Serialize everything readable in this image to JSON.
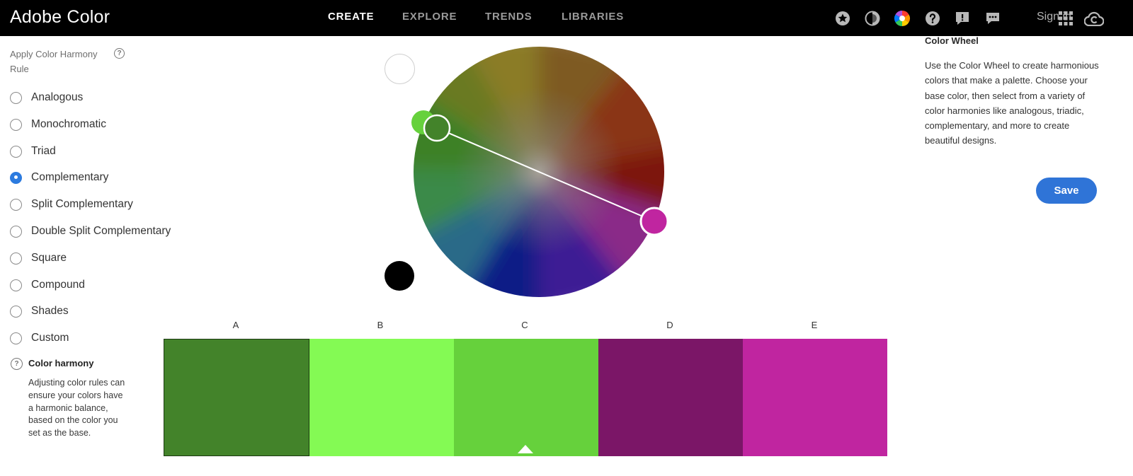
{
  "app": {
    "title": "Adobe Color"
  },
  "nav": {
    "items": [
      {
        "label": "CREATE",
        "active": true
      },
      {
        "label": "EXPLORE",
        "active": false
      },
      {
        "label": "TRENDS",
        "active": false
      },
      {
        "label": "LIBRARIES",
        "active": false
      }
    ]
  },
  "header_icons": [
    "star-icon",
    "contrast-icon",
    "color-wheel-icon",
    "help-icon",
    "feedback-icon",
    "chat-icon",
    "apps-grid-icon",
    "creative-cloud-icon"
  ],
  "header": {
    "sign_in": "Sign in"
  },
  "harmony_panel": {
    "title": "Apply Color Harmony Rule",
    "rules": [
      {
        "label": "Analogous",
        "selected": false
      },
      {
        "label": "Monochromatic",
        "selected": false
      },
      {
        "label": "Triad",
        "selected": false
      },
      {
        "label": "Complementary",
        "selected": true
      },
      {
        "label": "Split Complementary",
        "selected": false
      },
      {
        "label": "Double Split Complementary",
        "selected": false
      },
      {
        "label": "Square",
        "selected": false
      },
      {
        "label": "Compound",
        "selected": false
      },
      {
        "label": "Shades",
        "selected": false
      },
      {
        "label": "Custom",
        "selected": false
      }
    ],
    "note_title": "Color harmony",
    "note_text": "Adjusting color rules can ensure your colors have a harmonic balance, based on the color you set as the base."
  },
  "palette": {
    "columns": [
      {
        "letter": "A",
        "color": "#43832a"
      },
      {
        "letter": "B",
        "color": "#84fa54"
      },
      {
        "letter": "C",
        "color": "#66d13c"
      },
      {
        "letter": "D",
        "color": "#7b1667"
      },
      {
        "letter": "E",
        "color": "#c025a0"
      }
    ],
    "selected_index": 0,
    "base_index": 2
  },
  "info_panel": {
    "title": "Color Wheel",
    "text": "Use the Color Wheel to create harmonious colors that make a palette. Choose your base color, then select from a variety of color harmonies like analogous, triadic, complementary, and more to create beautiful designs.",
    "save_label": "Save"
  },
  "colors": {
    "accent": "#2f74d7",
    "handle_green": "#66d13c",
    "handle_green_dark": "#43832a",
    "handle_magenta": "#c025a0"
  }
}
